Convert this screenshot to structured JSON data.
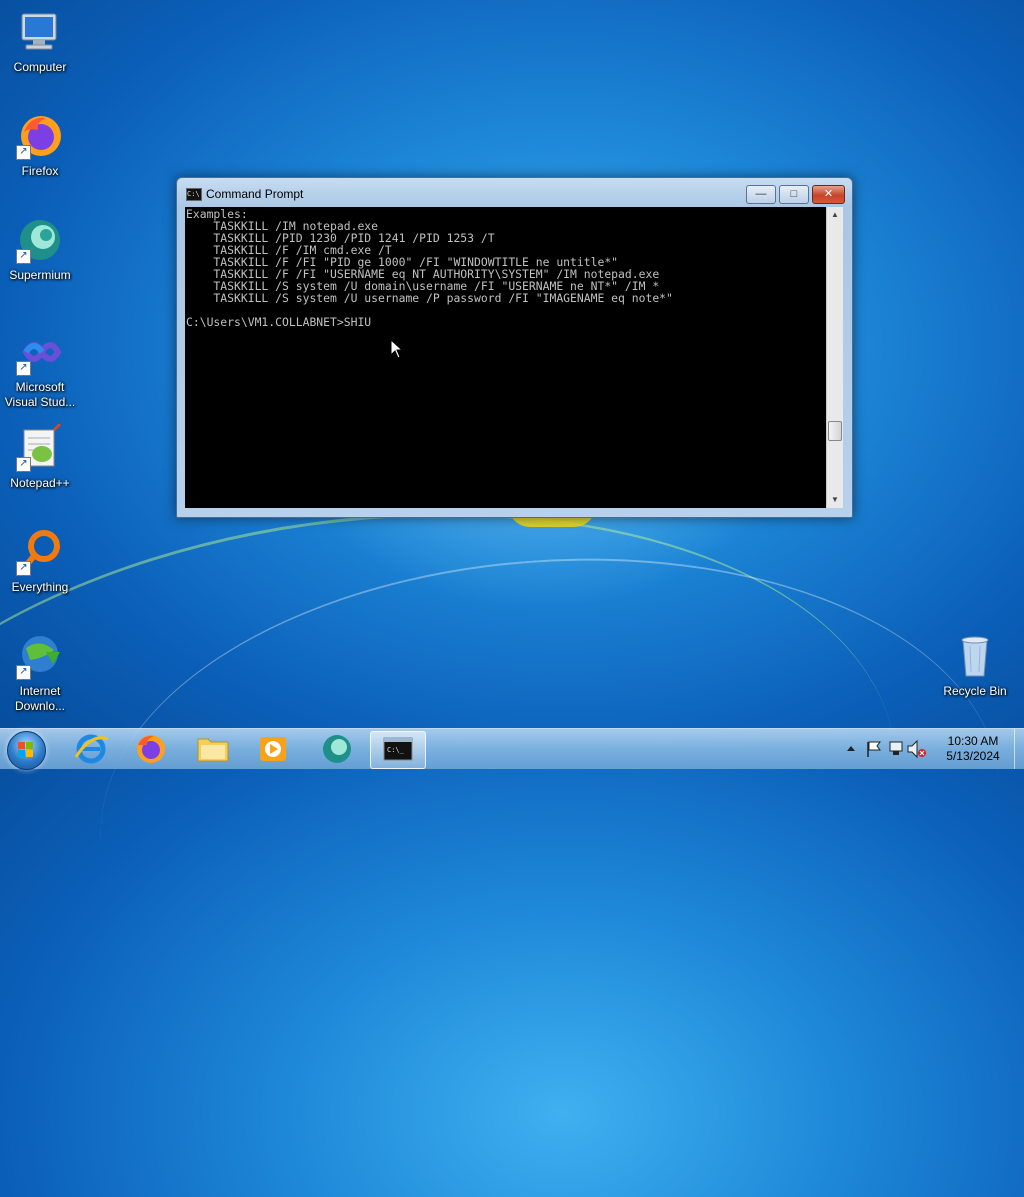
{
  "desktop": {
    "icons": [
      {
        "label": "Computer",
        "icon": "computer-icon"
      },
      {
        "label": "Firefox",
        "icon": "firefox-icon"
      },
      {
        "label": "Supermium",
        "icon": "supermium-icon"
      },
      {
        "label": "Microsoft Visual Stud...",
        "icon": "visual-studio-icon"
      },
      {
        "label": "Notepad++",
        "icon": "notepadpp-icon"
      },
      {
        "label": "Everything",
        "icon": "everything-icon"
      },
      {
        "label": "Internet Downlo...",
        "icon": "internet-download-manager-icon"
      },
      {
        "label": "Recycle Bin",
        "icon": "recycle-bin-icon"
      }
    ]
  },
  "window": {
    "title": "Command Prompt",
    "buttons": {
      "minimize": "—",
      "maximize": "□",
      "close": "✕"
    },
    "console_lines": [
      "Examples:",
      "    TASKKILL /IM notepad.exe",
      "    TASKKILL /PID 1230 /PID 1241 /PID 1253 /T",
      "    TASKKILL /F /IM cmd.exe /T",
      "    TASKKILL /F /FI \"PID ge 1000\" /FI \"WINDOWTITLE ne untitle*\"",
      "    TASKKILL /F /FI \"USERNAME eq NT AUTHORITY\\SYSTEM\" /IM notepad.exe",
      "    TASKKILL /S system /U domain\\username /FI \"USERNAME ne NT*\" /IM *",
      "    TASKKILL /S system /U username /P password /FI \"IMAGENAME eq note*\"",
      "",
      "C:\\Users\\VM1.COLLABNET>SHIU"
    ]
  },
  "taskbar": {
    "pinned": [
      {
        "name": "internet-explorer",
        "icon": "internet-explorer-icon"
      },
      {
        "name": "firefox",
        "icon": "firefox-icon"
      },
      {
        "name": "file-explorer",
        "icon": "folder-icon"
      },
      {
        "name": "media-player",
        "icon": "media-player-icon"
      },
      {
        "name": "supermium",
        "icon": "supermium-icon"
      },
      {
        "name": "command-prompt",
        "icon": "cmd-icon",
        "active": true
      }
    ],
    "tray": {
      "time": "10:30 AM",
      "date": "5/13/2024"
    }
  },
  "colors": {
    "console_bg": "#000000",
    "console_text": "#c0c0c0",
    "close_button": "#c7432a"
  }
}
